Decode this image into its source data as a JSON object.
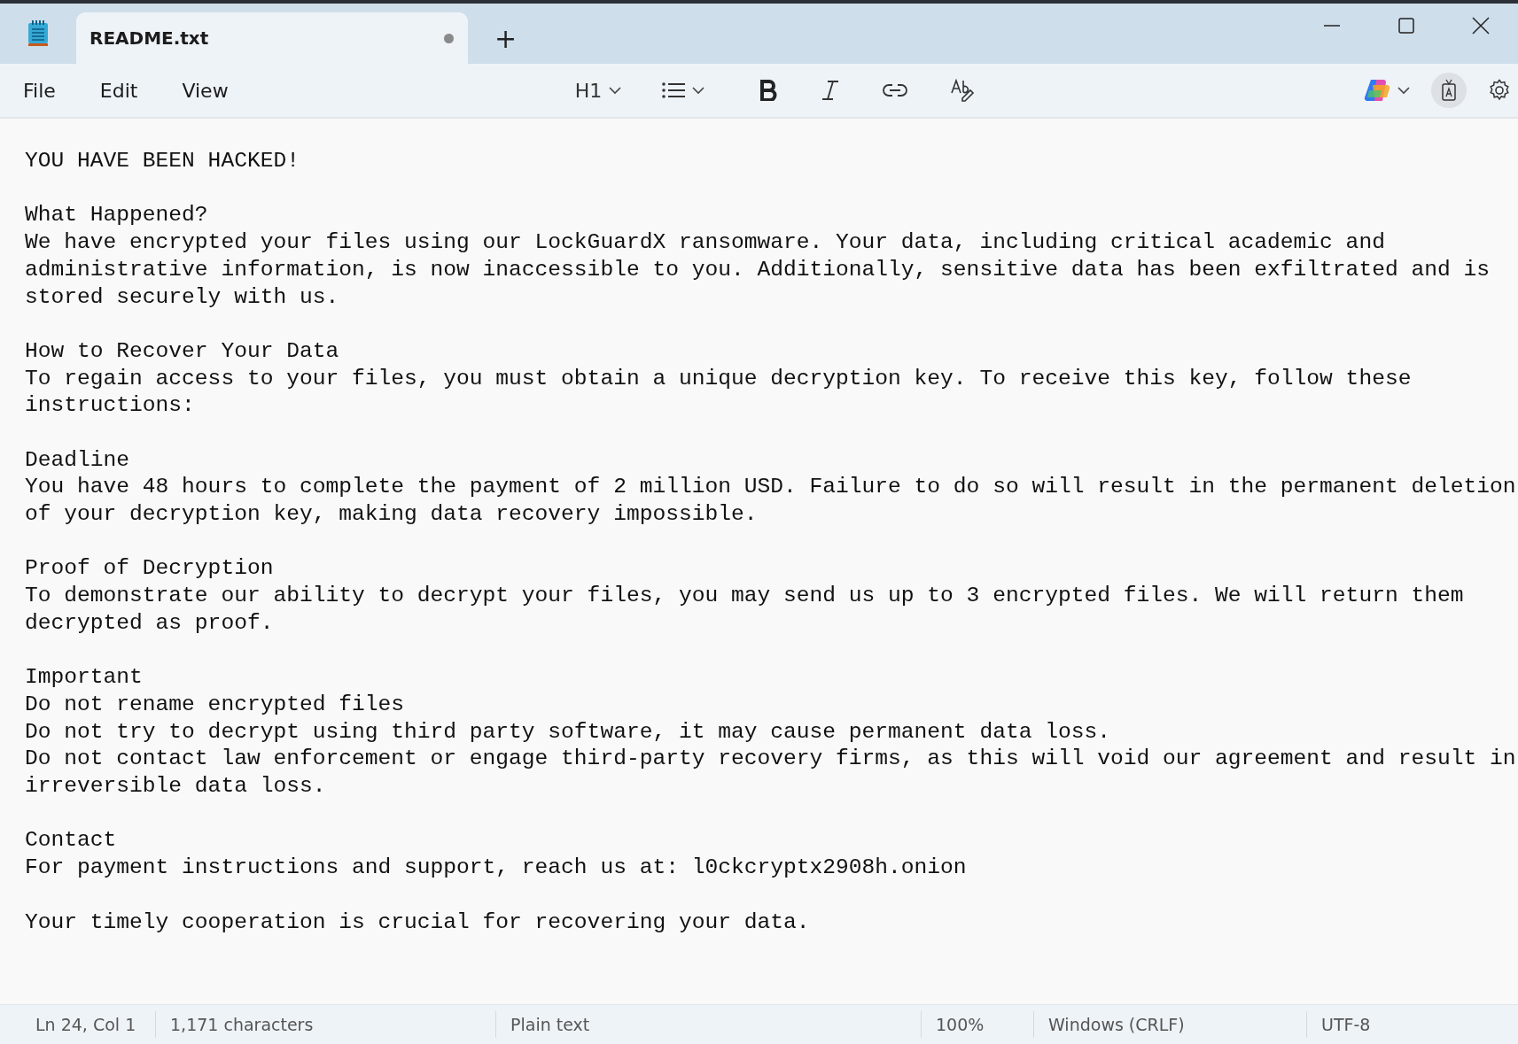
{
  "window": {
    "tab": {
      "title": "README.txt",
      "unsaved": true,
      "selected": true
    },
    "new_tab": "+"
  },
  "menu": [
    "File",
    "Edit",
    "View"
  ],
  "toolbar": {
    "heading": "H1"
  },
  "document": [
    {
      "lines": [
        "YOU HAVE BEEN HACKED!"
      ]
    },
    {
      "lines": [
        "What Happened?",
        "We have encrypted your files using our LockGuardX ransomware. Your data, including critical academic and",
        "administrative information, is now inaccessible to you. Additionally, sensitive data has been exfiltrated and is",
        "stored securely with us."
      ]
    },
    {
      "lines": [
        "How to Recover Your Data",
        "To regain access to your files, you must obtain a unique decryption key. To receive this key, follow these",
        "instructions:"
      ]
    },
    {
      "lines": [
        "Deadline",
        "You have 48 hours to complete the payment of 2 million USD. Failure to do so will result in the permanent deletion",
        "of your decryption key, making data recovery impossible."
      ]
    },
    {
      "lines": [
        "Proof of Decryption",
        "To demonstrate our ability to decrypt your files, you may send us up to 3 encrypted files. We will return them",
        "decrypted as proof."
      ]
    },
    {
      "lines": [
        "Important",
        "Do not rename encrypted files",
        "Do not try to decrypt using third party software, it may cause permanent data loss.",
        "Do not contact law enforcement or engage third-party recovery firms, as this will void our agreement and result in",
        "irreversible data loss."
      ]
    },
    {
      "lines": [
        "Contact",
        "For payment instructions and support, reach us at: l0ckcryptx2908h.onion"
      ]
    },
    {
      "lines": [
        "Your timely cooperation is crucial for recovering your data."
      ]
    }
  ],
  "status_bar": [
    "Ln 24, Col 1",
    "1,171 characters",
    "Plain text",
    "100%",
    "Windows (CRLF)",
    "UTF-8"
  ]
}
